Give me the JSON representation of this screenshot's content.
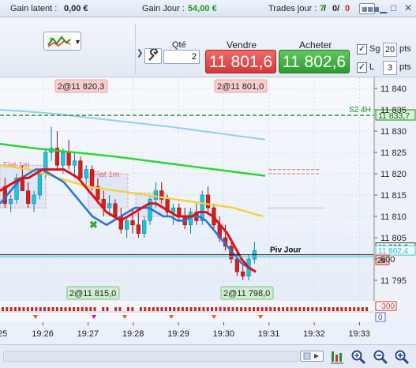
{
  "status": {
    "unrealized_label": "Gain latent :",
    "unrealized_value": "0,00 €",
    "day_gain_label": "Gain Jour :",
    "day_gain_value": "54,00 €",
    "trades_label": "Trades jour :",
    "trades_a": "7",
    "trades_sep1": " / ",
    "trades_b": "0",
    "trades_sep2": " / ",
    "trades_c": "0",
    "colors": {
      "gain": "#1a9a1a",
      "trades_win": "#1a9a1a",
      "trades_loss": "#cc2222"
    }
  },
  "toolbar": {
    "qty_label": "Qté",
    "qty_value": "2",
    "sell_label": "Vendre",
    "buy_label": "Acheter",
    "sell_price": "11 801,6",
    "buy_price": "11 802,6",
    "sg_label": "Sg",
    "sg_points": "20",
    "l_label": "L",
    "l_points": "3",
    "pts_unit": "pts",
    "indicator_icon": "chart-indicator-icon",
    "wrench_icon": "wrench-icon",
    "keyboard_icon": "keyboard-icon"
  },
  "chart_data": {
    "type": "candlestick",
    "y_range": [
      11792,
      11842
    ],
    "y_ticks": [
      11795,
      11800,
      11805,
      11810,
      11815,
      11820,
      11825,
      11830,
      11835,
      11840
    ],
    "y_tick_labels": [
      "11 795",
      "800",
      "11 805",
      "11 810",
      "11 815",
      "11 820",
      "11 825",
      "11 830",
      "11 835",
      "11 840"
    ],
    "x_ticks": [
      "25",
      "19:26",
      "19:27",
      "19:28",
      "19:29",
      "19:30",
      "19:31",
      "19:32",
      "19:33"
    ],
    "candles": [
      [
        11817,
        11819,
        11812,
        11813
      ],
      [
        11813,
        11815,
        11811,
        11814
      ],
      [
        11814,
        11820,
        11813,
        11819
      ],
      [
        11819,
        11822,
        11816,
        11816
      ],
      [
        11816,
        11818,
        11812,
        11813
      ],
      [
        11813,
        11816,
        11811,
        11815
      ],
      [
        11815,
        11821,
        11814,
        11820
      ],
      [
        11820,
        11826,
        11819,
        11825
      ],
      [
        11825,
        11831,
        11823,
        11826
      ],
      [
        11826,
        11830,
        11821,
        11822
      ],
      [
        11822,
        11826,
        11820,
        11825
      ],
      [
        11825,
        11828,
        11821,
        11822
      ],
      [
        11822,
        11825,
        11819,
        11823
      ],
      [
        11823,
        11824,
        11818,
        11819
      ],
      [
        11819,
        11822,
        11817,
        11821
      ],
      [
        11821,
        11822,
        11816,
        11817
      ],
      [
        11817,
        11819,
        11813,
        11814
      ],
      [
        11814,
        11816,
        11810,
        11812
      ],
      [
        11812,
        11815,
        11810,
        11813
      ],
      [
        11813,
        11814,
        11809,
        11810
      ],
      [
        11810,
        11812,
        11806,
        11807
      ],
      [
        11807,
        11810,
        11805,
        11809
      ],
      [
        11809,
        11812,
        11806,
        11808
      ],
      [
        11808,
        11811,
        11805,
        11806
      ],
      [
        11806,
        11810,
        11805,
        11809
      ],
      [
        11809,
        11815,
        11808,
        11814
      ],
      [
        11814,
        11818,
        11812,
        11816
      ],
      [
        11816,
        11818,
        11813,
        11814
      ],
      [
        11814,
        11815,
        11810,
        11811
      ],
      [
        11811,
        11813,
        11808,
        11812
      ],
      [
        11812,
        11813,
        11809,
        11810
      ],
      [
        11810,
        11812,
        11807,
        11808
      ],
      [
        11808,
        11812,
        11806,
        11811
      ],
      [
        11811,
        11813,
        11808,
        11809
      ],
      [
        11809,
        11816,
        11808,
        11815
      ],
      [
        11815,
        11817,
        11811,
        11812
      ],
      [
        11812,
        11813,
        11807,
        11808
      ],
      [
        11808,
        11810,
        11804,
        11805
      ],
      [
        11805,
        11808,
        11802,
        11803
      ],
      [
        11803,
        11805,
        11799,
        11800
      ],
      [
        11800,
        11802,
        11796,
        11797
      ],
      [
        11797,
        11799,
        11795,
        11796
      ],
      [
        11796,
        11801,
        11795,
        11800
      ],
      [
        11800,
        11804,
        11799,
        11802
      ]
    ],
    "ma_red": [
      11816,
      11817,
      11818,
      11819,
      11819,
      11820,
      11821,
      11821,
      11821,
      11821,
      11820,
      11819,
      11817,
      11815,
      11813,
      11811,
      11810,
      11809,
      11810,
      11811,
      11812,
      11813,
      11813,
      11812,
      11811,
      11810,
      11810,
      11810,
      11811,
      11811,
      11810,
      11808,
      11806,
      11803,
      11800,
      11798,
      11797
    ],
    "ma_blue": [
      11813,
      11815,
      11817,
      11819,
      11820,
      11821,
      11821,
      11820,
      11819,
      11818,
      11816,
      11814,
      11812,
      11810,
      11809,
      11808,
      11809,
      11810,
      11811,
      11812,
      11812,
      11812,
      11811,
      11810,
      11810,
      11809,
      11809,
      11810,
      11810,
      11809,
      11807,
      11805,
      11803,
      11801,
      11799,
      11798,
      11797
    ],
    "ma_yellow": [
      11822,
      11821.5,
      11821,
      11820,
      11819,
      11818,
      11817,
      11816.5,
      11816,
      11815.5,
      11815,
      11814.5,
      11814,
      11813.5,
      11813,
      11812.5,
      11812,
      11811,
      11810
    ],
    "ma_green": [
      11827,
      11826.5,
      11826,
      11825.6,
      11825.2,
      11824.8,
      11824.4,
      11824,
      11823.5,
      11823,
      11822.5,
      11822,
      11821.5,
      11821,
      11820.5,
      11820,
      11819.5
    ],
    "ma_lightblue": [
      11835,
      11834.7,
      11834.4,
      11834,
      11833.5,
      11833,
      11832.5,
      11832,
      11831.5,
      11831,
      11830.4,
      11829.8,
      11829.2,
      11828.6,
      11828
    ],
    "levels": {
      "s2": 11833.7,
      "piv": 11801.0,
      "last": 11802.4,
      "s2_label": "S2 4H",
      "piv_label": "Piv Jour",
      "s2_tag": "11 833,7",
      "last_tag": "11 802,4",
      "piv_tag": "11 802,8",
      "timer_tag": "2s"
    },
    "order_tags": [
      {
        "text": "2@11 820,3",
        "kind": "sell",
        "pos": "top-left"
      },
      {
        "text": "2@11 801,0",
        "kind": "sell",
        "pos": "top-right"
      },
      {
        "text": "2@11 815,0",
        "kind": "buy",
        "pos": "bottom-left"
      },
      {
        "text": "2@11 798,0",
        "kind": "buy",
        "pos": "bottom-right"
      }
    ],
    "zone_labels": [
      "Flat 1m",
      "Flat 1m"
    ],
    "sub_scale_labels": [
      "-300",
      "0"
    ]
  },
  "bottom": {
    "icons": [
      "scroll-right-icon",
      "chart-settings-icon",
      "zoom-fit-icon",
      "zoom-out-icon",
      "zoom-in-icon"
    ]
  }
}
